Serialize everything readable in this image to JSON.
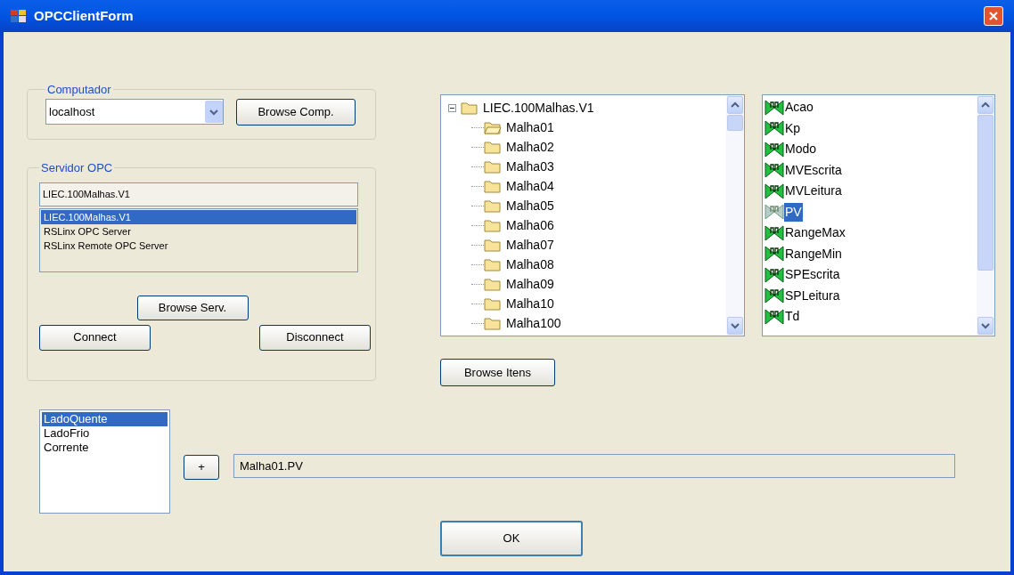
{
  "window": {
    "title": "OPCClientForm"
  },
  "computador": {
    "legend": "Computador",
    "combo_value": "localhost",
    "browse_button": "Browse Comp."
  },
  "servidor": {
    "legend": "Servidor OPC",
    "value": "LIEC.100Malhas.V1",
    "browse_button": "Browse Serv.",
    "connect_button": "Connect",
    "disconnect_button": "Disconnect",
    "servers": [
      {
        "label": "LIEC.100Malhas.V1",
        "selected": true
      },
      {
        "label": "RSLinx OPC Server",
        "selected": false
      },
      {
        "label": "RSLinx Remote OPC Server",
        "selected": false
      }
    ]
  },
  "tree": {
    "label": "LIEC.100Malhas.V1",
    "expanded": true,
    "children": [
      {
        "label": "Malha01",
        "open": true
      },
      {
        "label": "Malha02",
        "open": false
      },
      {
        "label": "Malha03",
        "open": false
      },
      {
        "label": "Malha04",
        "open": false
      },
      {
        "label": "Malha05",
        "open": false
      },
      {
        "label": "Malha06",
        "open": false
      },
      {
        "label": "Malha07",
        "open": false
      },
      {
        "label": "Malha08",
        "open": false
      },
      {
        "label": "Malha09",
        "open": false
      },
      {
        "label": "Malha10",
        "open": false
      },
      {
        "label": "Malha100",
        "open": false
      }
    ]
  },
  "browse_items_button": "Browse Itens",
  "items": [
    {
      "label": "Acao",
      "selected": false
    },
    {
      "label": "Kp",
      "selected": false
    },
    {
      "label": "Modo",
      "selected": false
    },
    {
      "label": "MVEscrita",
      "selected": false
    },
    {
      "label": "MVLeitura",
      "selected": false
    },
    {
      "label": "PV",
      "selected": true
    },
    {
      "label": "RangeMax",
      "selected": false
    },
    {
      "label": "RangeMin",
      "selected": false
    },
    {
      "label": "SPEscrita",
      "selected": false
    },
    {
      "label": "SPLeitura",
      "selected": false
    },
    {
      "label": "Td",
      "selected": false
    }
  ],
  "variables": [
    {
      "label": "LadoQuente",
      "selected": true
    },
    {
      "label": "LadoFrio",
      "selected": false
    },
    {
      "label": "Corrente",
      "selected": false
    }
  ],
  "add_button": "+",
  "item_path": "Malha01.PV",
  "ok_button": "OK"
}
